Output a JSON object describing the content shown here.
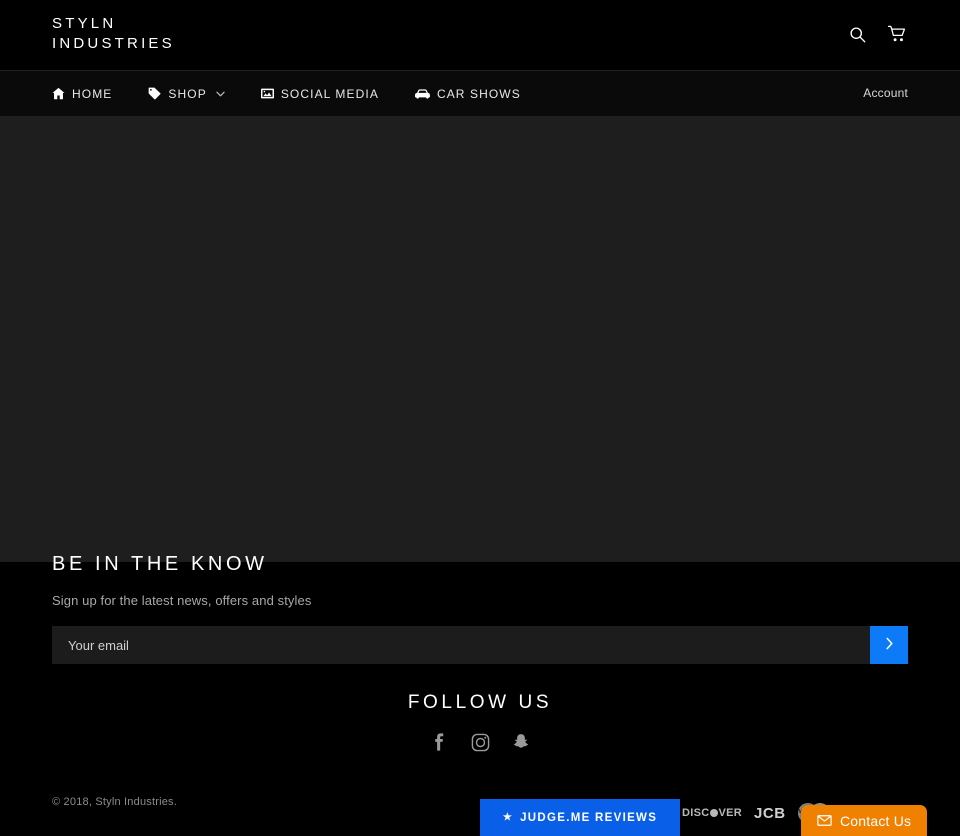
{
  "header": {
    "logo_line1": "STYLN",
    "logo_line2": "INDUSTRIES",
    "search_icon": "search-icon",
    "cart_icon": "cart-icon"
  },
  "nav": {
    "items": [
      {
        "label": "HOME",
        "icon": "home-icon",
        "has_caret": false
      },
      {
        "label": "SHOP",
        "icon": "tag-icon",
        "has_caret": true
      },
      {
        "label": "SOCIAL MEDIA",
        "icon": "image-icon",
        "has_caret": false
      },
      {
        "label": "CAR SHOWS",
        "icon": "car-icon",
        "has_caret": false
      }
    ],
    "account_label": "Account"
  },
  "newsletter": {
    "title": "BE IN THE KNOW",
    "subtitle": "Sign up for the latest news, offers and styles",
    "email_placeholder": "Your email",
    "email_value": "",
    "submit_icon": "chevron-right-icon",
    "submit_color": "#0d7bf7"
  },
  "follow": {
    "title": "FOLLOW US",
    "socials": [
      {
        "name": "facebook-icon",
        "label": "Facebook"
      },
      {
        "name": "instagram-icon",
        "label": "Instagram"
      },
      {
        "name": "snapchat-icon",
        "label": "Snapchat"
      }
    ]
  },
  "footer": {
    "copyright": "© 2018, Styln Industries.",
    "judgeme": {
      "star": "★",
      "label": "JUDGE.ME REVIEWS",
      "color": "#0a5fe8"
    },
    "payments": [
      {
        "name": "discover-icon",
        "label": "DISC VER"
      },
      {
        "name": "jcb-icon",
        "label": "JCB"
      },
      {
        "name": "mastercard-icon",
        "label": "Mastercard"
      }
    ],
    "contact": {
      "label": "Contact Us",
      "icon": "envelope-icon",
      "color": "#f08000"
    }
  }
}
